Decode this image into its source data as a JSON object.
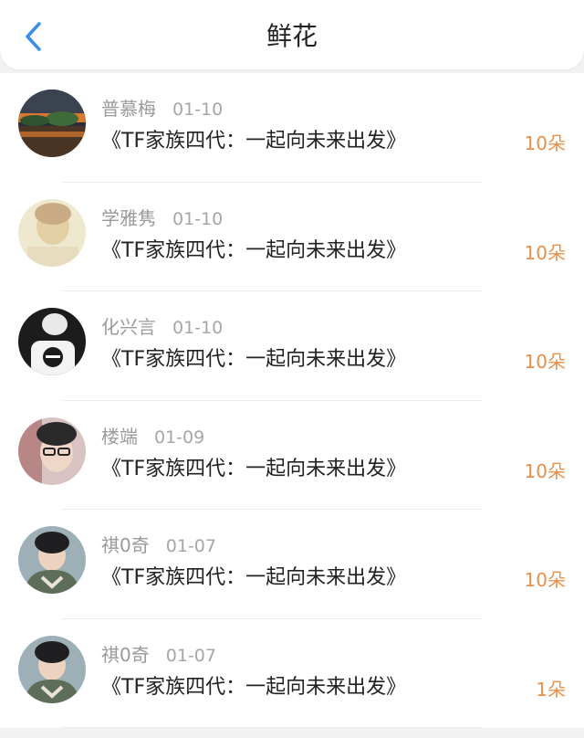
{
  "header": {
    "title": "鲜花",
    "back_icon": "chevron-left-icon",
    "accent_color": "#3a8ee6"
  },
  "colors": {
    "amount": "#e8904a",
    "name": "#9a9a9a"
  },
  "rows": [
    {
      "name": "普慕梅",
      "date": "01-10",
      "book": "《TF家族四代：一起向未来出发》",
      "amount": "10朵"
    },
    {
      "name": "学雅隽",
      "date": "01-10",
      "book": "《TF家族四代：一起向未来出发》",
      "amount": "10朵"
    },
    {
      "name": "化兴言",
      "date": "01-10",
      "book": "《TF家族四代：一起向未来出发》",
      "amount": "10朵"
    },
    {
      "name": "楼端",
      "date": "01-09",
      "book": "《TF家族四代：一起向未来出发》",
      "amount": "10朵"
    },
    {
      "name": "祺0奇",
      "date": "01-07",
      "book": "《TF家族四代：一起向未来出发》",
      "amount": "10朵"
    },
    {
      "name": "祺0奇",
      "date": "01-07",
      "book": "《TF家族四代：一起向未来出发》",
      "amount": "1朵"
    }
  ]
}
